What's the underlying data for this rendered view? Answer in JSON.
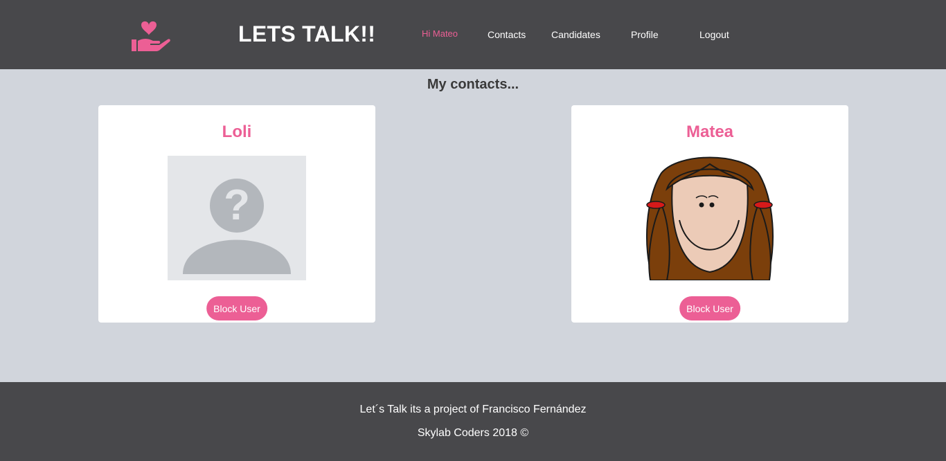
{
  "header": {
    "logo_icon": "heart-in-hand-icon",
    "brand": "LETS TALK!!",
    "greeting": "Hi Mateo",
    "nav": [
      "Contacts",
      "Candidates",
      "Profile",
      "Logout"
    ]
  },
  "main": {
    "title": "My contacts...",
    "contacts": [
      {
        "name": "Loli",
        "avatar": "unknown-user-placeholder-icon",
        "button": "Block User"
      },
      {
        "name": "Matea",
        "avatar": "girl-cartoon-avatar",
        "button": "Block User"
      }
    ]
  },
  "footer": {
    "line1": "Let´s Talk its a project of Francisco Fernández",
    "line2": "Skylab Coders 2018 ©"
  },
  "colors": {
    "header_bg": "#48484b",
    "accent": "#ec5f95",
    "page_bg": "#d1d5dc",
    "card_bg": "#ffffff"
  }
}
